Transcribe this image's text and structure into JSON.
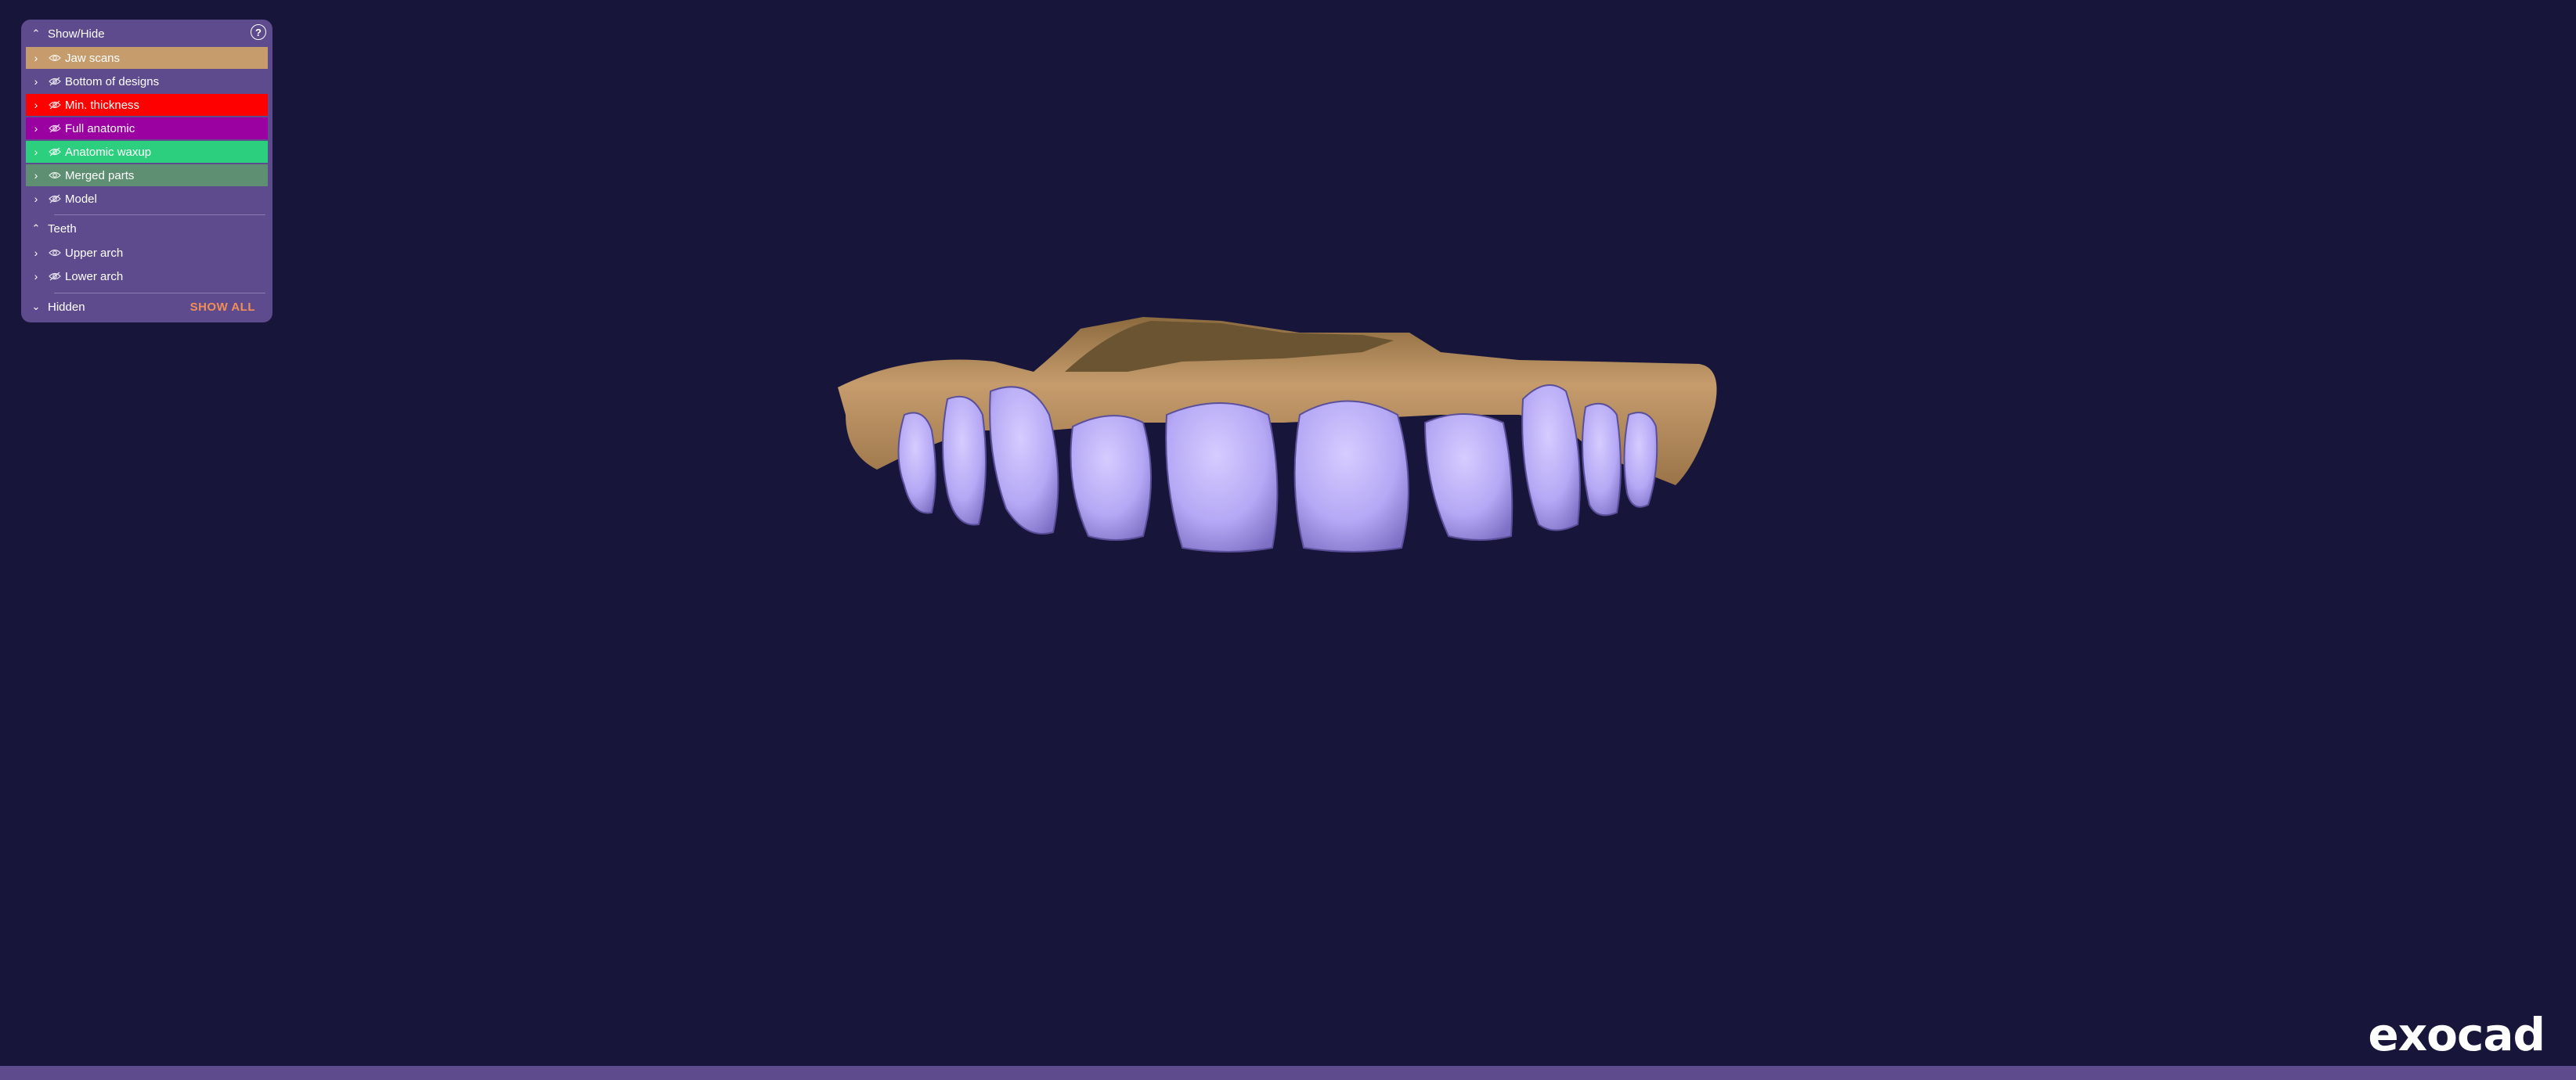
{
  "panel": {
    "title": "Show/Hide",
    "items": [
      {
        "label": "Jaw scans",
        "color": "#c69c6d",
        "eye": "eye-open"
      },
      {
        "label": "Bottom of designs",
        "color": "#5e4b8d",
        "eye": "eye-hidden"
      },
      {
        "label": "Min. thickness",
        "color": "#ff0000",
        "eye": "eye-hidden"
      },
      {
        "label": "Full anatomic",
        "color": "#9b00a0",
        "eye": "eye-hidden"
      },
      {
        "label": "Anatomic waxup",
        "color": "#2ccf7e",
        "eye": "eye-hidden"
      },
      {
        "label": "Merged parts",
        "color": "#5e8f72",
        "eye": "eye-open"
      },
      {
        "label": "Model",
        "color": "#5e4b8d",
        "eye": "eye-hidden"
      }
    ],
    "teeth_title": "Teeth",
    "teeth_items": [
      {
        "label": "Upper arch",
        "eye": "eye-open"
      },
      {
        "label": "Lower arch",
        "eye": "eye-hidden"
      }
    ],
    "hidden_title": "Hidden",
    "show_all": "SHOW ALL"
  },
  "viewport": {
    "gum_color": "#c69c6d",
    "tooth_color": "#b5a8f5"
  },
  "branding": {
    "logo": "exocad"
  }
}
